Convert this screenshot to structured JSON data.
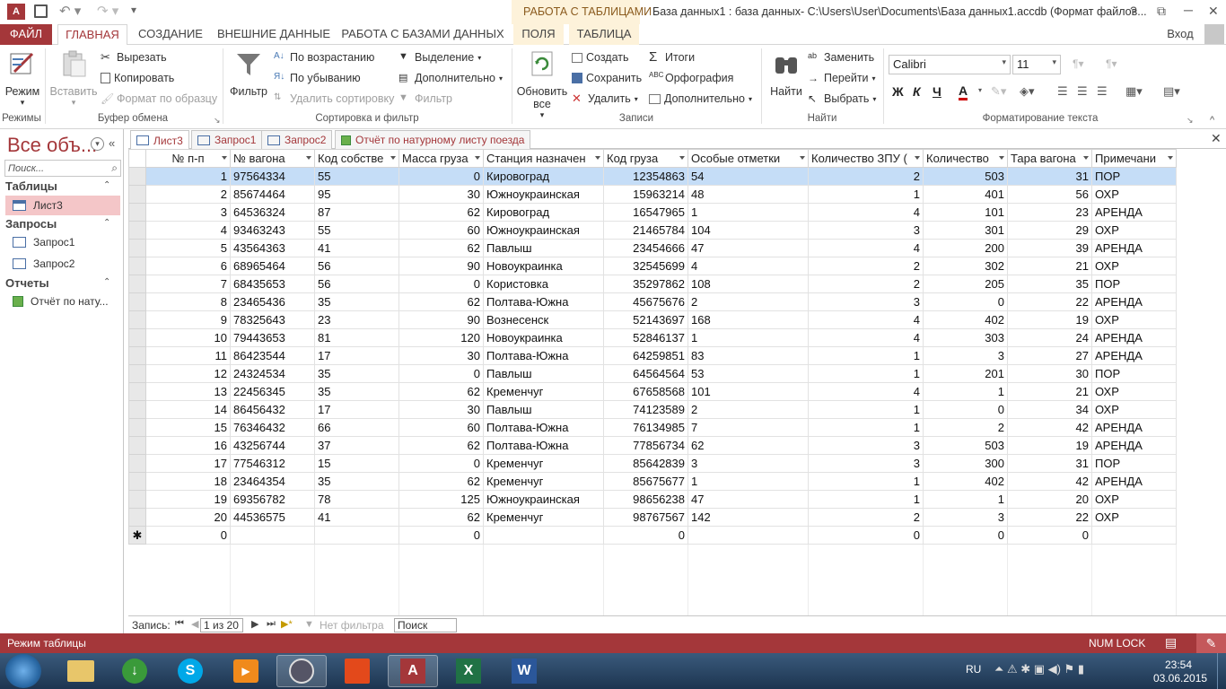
{
  "titlebar": {
    "context_tab": "РАБОТА С ТАБЛИЦАМИ",
    "title": "База данных1 : база данных- C:\\Users\\User\\Documents\\База данных1.accdb (Формат файлов...",
    "help": "?",
    "minimize": "─",
    "restore": "❐",
    "close": "✕"
  },
  "tabs": {
    "file": "ФАЙЛ",
    "home": "ГЛАВНАЯ",
    "create": "СОЗДАНИЕ",
    "external": "ВНЕШНИЕ ДАННЫЕ",
    "dbtools": "РАБОТА С БАЗАМИ ДАННЫХ",
    "fields": "ПОЛЯ",
    "table": "ТАБЛИЦА",
    "signin": "Вход"
  },
  "ribbon": {
    "views": {
      "label": "Режимы",
      "mode": "Режим"
    },
    "clipboard": {
      "label": "Буфер обмена",
      "paste": "Вставить",
      "cut": "Вырезать",
      "copy": "Копировать",
      "format_painter": "Формат по образцу"
    },
    "sort": {
      "label": "Сортировка и фильтр",
      "filter": "Фильтр",
      "asc": "По возрастанию",
      "desc": "По убыванию",
      "remove_sort": "Удалить сортировку",
      "selection": "Выделение",
      "advanced": "Дополнительно",
      "toggle_filter": "Фильтр"
    },
    "records": {
      "label": "Записи",
      "refresh_all": "Обновить все",
      "new": "Создать",
      "save": "Сохранить",
      "delete": "Удалить",
      "totals": "Итоги",
      "spelling": "Орфография",
      "more": "Дополнительно"
    },
    "find": {
      "label": "Найти",
      "find": "Найти",
      "replace": "Заменить",
      "goto": "Перейти",
      "select": "Выбрать"
    },
    "text": {
      "label": "Форматирование текста",
      "font": "Calibri",
      "size": "11",
      "bold": "Ж",
      "italic": "К",
      "underline": "Ч"
    }
  },
  "nav": {
    "header": "Все объ...",
    "search_placeholder": "Поиск...",
    "groups": [
      {
        "title": "Таблицы",
        "items": [
          "Лист3"
        ]
      },
      {
        "title": "Запросы",
        "items": [
          "Запрос1",
          "Запрос2"
        ]
      },
      {
        "title": "Отчеты",
        "items": [
          "Отчёт по нату..."
        ]
      }
    ]
  },
  "doc_tabs": [
    "Лист3",
    "Запрос1",
    "Запрос2",
    "Отчёт по натурному листу поезда"
  ],
  "table": {
    "columns": [
      "№ п-п",
      "№ вагона",
      "Код собстве",
      "Масса груза",
      "Станция назначен",
      "Код груза",
      "Особые отметки",
      "Количество ЗПУ (",
      "Количество",
      "Тара вагона",
      "Примечани"
    ],
    "rows": [
      [
        "1",
        "97564334",
        "55",
        "0",
        "Кировоград",
        "12354863",
        "54",
        "2",
        "503",
        "31",
        "ПОР"
      ],
      [
        "2",
        "85674464",
        "95",
        "30",
        "Южноукраинская",
        "15963214",
        "48",
        "1",
        "401",
        "56",
        "ОХР"
      ],
      [
        "3",
        "64536324",
        "87",
        "62",
        "Кировоград",
        "16547965",
        "1",
        "4",
        "101",
        "23",
        "АРЕНДА"
      ],
      [
        "4",
        "93463243",
        "55",
        "60",
        "Южноукраинская",
        "21465784",
        "104",
        "3",
        "301",
        "29",
        "ОХР"
      ],
      [
        "5",
        "43564363",
        "41",
        "62",
        "Павлыш",
        "23454666",
        "47",
        "4",
        "200",
        "39",
        "АРЕНДА"
      ],
      [
        "6",
        "68965464",
        "56",
        "90",
        "Новоукраинка",
        "32545699",
        "4",
        "2",
        "302",
        "21",
        "ОХР"
      ],
      [
        "7",
        "68435653",
        "56",
        "0",
        "Користовка",
        "35297862",
        "108",
        "2",
        "205",
        "35",
        "ПОР"
      ],
      [
        "8",
        "23465436",
        "35",
        "62",
        "Полтава-Южна",
        "45675676",
        "2",
        "3",
        "0",
        "22",
        "АРЕНДА"
      ],
      [
        "9",
        "78325643",
        "23",
        "90",
        "Вознесенск",
        "52143697",
        "168",
        "4",
        "402",
        "19",
        "ОХР"
      ],
      [
        "10",
        "79443653",
        "81",
        "120",
        "Новоукраинка",
        "52846137",
        "1",
        "4",
        "303",
        "24",
        "АРЕНДА"
      ],
      [
        "11",
        "86423544",
        "17",
        "30",
        "Полтава-Южна",
        "64259851",
        "83",
        "1",
        "3",
        "27",
        "АРЕНДА"
      ],
      [
        "12",
        "24324534",
        "35",
        "0",
        "Павлыш",
        "64564564",
        "53",
        "1",
        "201",
        "30",
        "ПОР"
      ],
      [
        "13",
        "22456345",
        "35",
        "62",
        "Кременчуг",
        "67658568",
        "101",
        "4",
        "1",
        "21",
        "ОХР"
      ],
      [
        "14",
        "86456432",
        "17",
        "30",
        "Павлыш",
        "74123589",
        "2",
        "1",
        "0",
        "34",
        "ОХР"
      ],
      [
        "15",
        "76346432",
        "66",
        "60",
        "Полтава-Южна",
        "76134985",
        "7",
        "1",
        "2",
        "42",
        "АРЕНДА"
      ],
      [
        "16",
        "43256744",
        "37",
        "62",
        "Полтава-Южна",
        "77856734",
        "62",
        "3",
        "503",
        "19",
        "АРЕНДА"
      ],
      [
        "17",
        "77546312",
        "15",
        "0",
        "Кременчуг",
        "85642839",
        "3",
        "3",
        "300",
        "31",
        "ПОР"
      ],
      [
        "18",
        "23464354",
        "35",
        "62",
        "Кременчуг",
        "85675677",
        "1",
        "1",
        "402",
        "42",
        "АРЕНДА"
      ],
      [
        "19",
        "69356782",
        "78",
        "125",
        "Южноукраинская",
        "98656238",
        "47",
        "1",
        "1",
        "20",
        "ОХР"
      ],
      [
        "20",
        "44536575",
        "41",
        "62",
        "Кременчуг",
        "98767567",
        "142",
        "2",
        "3",
        "22",
        "ОХР"
      ]
    ],
    "new_row": [
      "0",
      "",
      "",
      "0",
      "",
      "0",
      "",
      "0",
      "0",
      "0",
      ""
    ]
  },
  "record_nav": {
    "label": "Запись:",
    "position": "1 из 20",
    "filter": "Нет фильтра",
    "search": "Поиск"
  },
  "status": {
    "mode": "Режим таблицы",
    "numlock": "NUM LOCK"
  },
  "taskbar": {
    "lang": "RU",
    "time": "23:54",
    "date": "03.06.2015"
  },
  "colors": {
    "access_red": "#a4373a",
    "selection_blue": "#c5ddf7"
  }
}
